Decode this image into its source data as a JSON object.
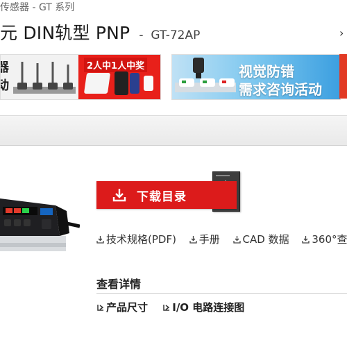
{
  "breadcrumb": "传感器 - GT 系列",
  "header": {
    "title": "元 DIN轨型 PNP",
    "dash": "-",
    "model": "GT-72AP",
    "next_icon": "chevron-right-icon"
  },
  "banners": {
    "left_text_1": "器",
    "left_text_2": "动",
    "campaign_1_tag": "2人中1人中奖",
    "campaign_2_line1": "视觉防错",
    "campaign_2_line2": "需求咨询活动"
  },
  "download": {
    "button_label": "下载目录",
    "button_icon": "download-icon",
    "links": [
      {
        "label": "技术规格(PDF)",
        "icon": "download-icon"
      },
      {
        "label": "手册",
        "icon": "download-icon"
      },
      {
        "label": "CAD 数据",
        "icon": "download-icon"
      },
      {
        "label": "360°查",
        "icon": "download-icon"
      }
    ]
  },
  "details": {
    "heading": "查看详情",
    "links": [
      {
        "label": "产品尺寸",
        "icon": "arrow-link-icon"
      },
      {
        "label": "I/O 电路连接图",
        "icon": "arrow-link-icon"
      }
    ]
  },
  "colors": {
    "accent_red": "#dc1b1b",
    "banner_blue": "#3c9fe0"
  }
}
